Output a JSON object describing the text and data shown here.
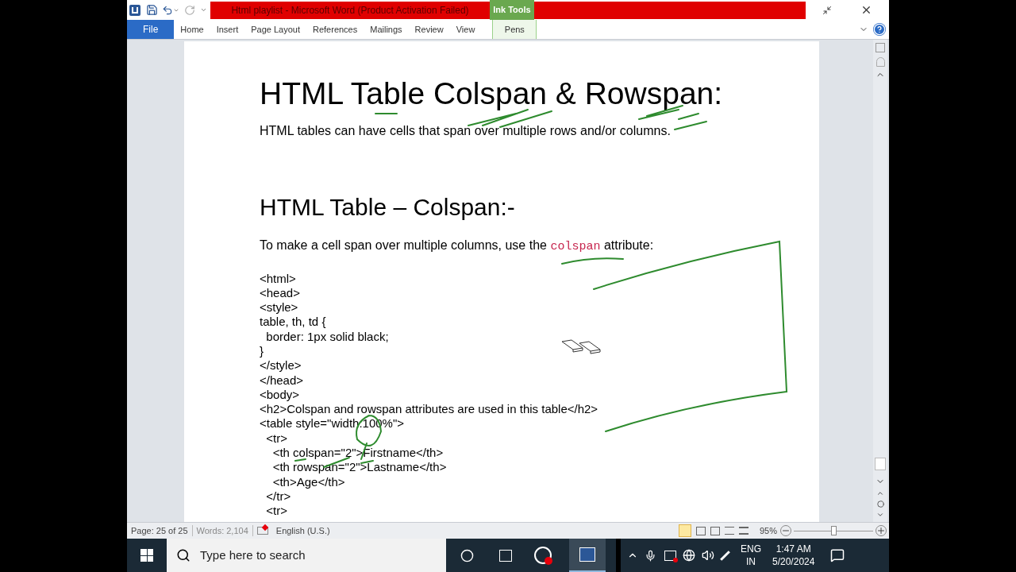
{
  "window": {
    "title": "Html playlist - Microsoft Word (Product Activation Failed)",
    "context_group": "Ink Tools"
  },
  "tabs": [
    {
      "label": "File",
      "kind": "file",
      "selected": false
    },
    {
      "label": "Home",
      "kind": "tab",
      "selected": false
    },
    {
      "label": "Insert",
      "kind": "tab",
      "selected": false
    },
    {
      "label": "Page Layout",
      "kind": "tab",
      "selected": false
    },
    {
      "label": "References",
      "kind": "tab",
      "selected": false
    },
    {
      "label": "Mailings",
      "kind": "tab",
      "selected": false
    },
    {
      "label": "Review",
      "kind": "tab",
      "selected": false
    },
    {
      "label": "View",
      "kind": "tab",
      "selected": false
    },
    {
      "label": "Pens",
      "kind": "context",
      "selected": false
    }
  ],
  "document": {
    "title": "HTML Table Colspan & Rowspan:",
    "intro": "HTML tables can have cells that span over multiple rows and/or columns.",
    "heading": "HTML Table – Colspan:-",
    "lead": {
      "before": "To make a cell span over multiple columns, use the",
      "code": "colspan",
      "after": "attribute:"
    },
    "code_lines": [
      "<html>",
      "<head>",
      "<style>",
      "table, th, td {",
      "  border: 1px solid black;",
      "}",
      "</style>",
      "</head>",
      "<body>",
      "<h2>Colspan and rowspan attributes are used in this table</h2>",
      "<table style=\"width:100%\">",
      "  <tr>",
      "    <th colspan=\"2\">Firstname</th>",
      "    <th rowspan=\"2\">Lastname</th>",
      "    <th>Age</th>",
      "  </tr>",
      "  <tr>"
    ]
  },
  "status_bar": {
    "page": "Page: 25 of 25",
    "words": "Words: 2,104",
    "language": "English (U.S.)",
    "zoom": "95%",
    "zoom_slider": {
      "level": 0.5
    }
  },
  "taskbar": {
    "search": {
      "placeholder": "Type here to search"
    },
    "input_language": "ENG",
    "region": "IN",
    "time": "1:47 AM",
    "date": "5/20/2024"
  }
}
